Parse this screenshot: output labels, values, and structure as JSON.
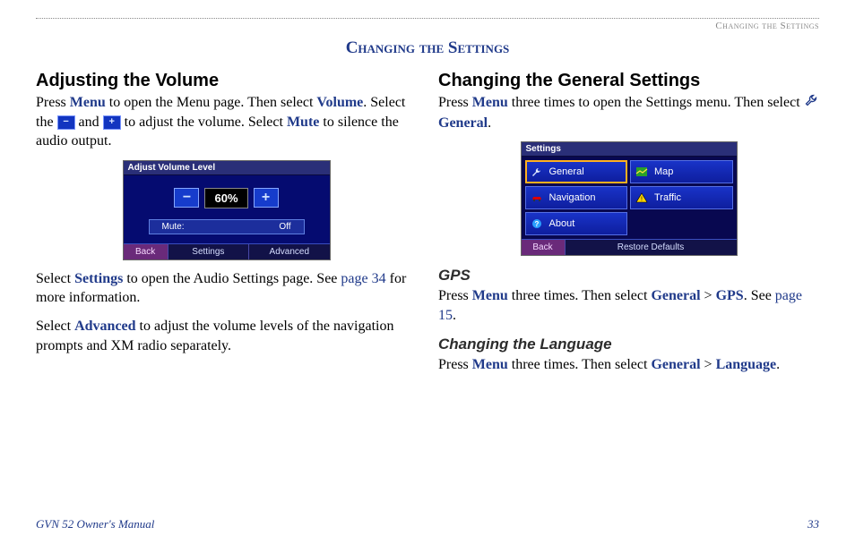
{
  "header_right": "Changing the Settings",
  "page_title": "Changing the Settings",
  "left": {
    "h2": "Adjusting the Volume",
    "p1a": "Press ",
    "kw_menu": "Menu",
    "p1b": " to open the Menu page. Then select ",
    "kw_volume": "Volume",
    "p1c": ". Select the ",
    "p1d": " and ",
    "p1e": " to adjust the volume. Select ",
    "kw_mute": "Mute",
    "p1f": " to silence the audio output.",
    "p2a": "Select ",
    "kw_settings": "Settings",
    "p2b": " to open the Audio Settings page. See ",
    "page34": "page 34",
    "p2c": " for more information.",
    "p3a": "Select ",
    "kw_adv": "Advanced",
    "p3b": " to adjust the volume levels of the navigation prompts and XM radio separately."
  },
  "ss1": {
    "title": "Adjust Volume Level",
    "percent": "60%",
    "mute_label": "Mute:",
    "mute_value": "Off",
    "back": "Back",
    "settings": "Settings",
    "advanced": "Advanced"
  },
  "right": {
    "h2": "Changing the General Settings",
    "p1a": "Press ",
    "kw_menu": "Menu",
    "p1b": " three times to open the Settings menu. Then select ",
    "kw_general": "General",
    "p1c": ".",
    "h3_gps": "GPS",
    "gps_a": "Press ",
    "gps_b": " three times. Then select ",
    "kw_general2": "General",
    "gps_gt": " > ",
    "kw_gps": "GPS",
    "gps_c": ". See ",
    "page15": "page 15",
    "gps_d": ".",
    "h3_lang": "Changing the Language",
    "lang_a": "Press ",
    "lang_b": " three times. Then select ",
    "kw_general3": "General",
    "lang_gt": " > ",
    "kw_lang": "Language",
    "lang_c": "."
  },
  "ss2": {
    "title": "Settings",
    "general": "General",
    "map": "Map",
    "navigation": "Navigation",
    "traffic": "Traffic",
    "about": "About",
    "back": "Back",
    "restore": "Restore Defaults"
  },
  "footer_left": "GVN 52 Owner's Manual",
  "footer_right": "33"
}
